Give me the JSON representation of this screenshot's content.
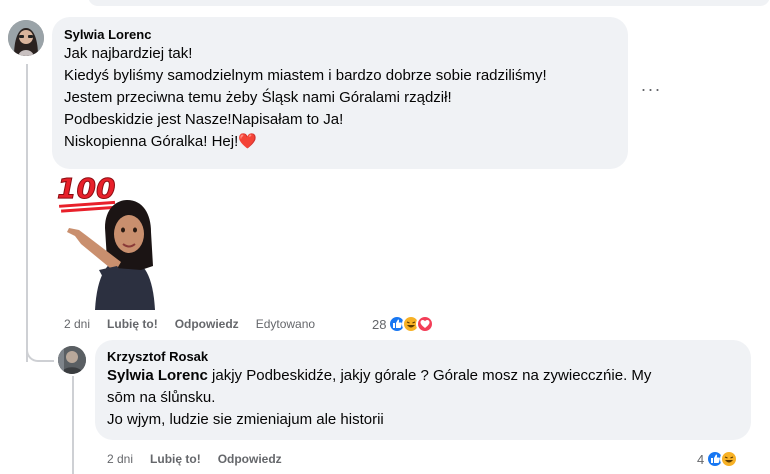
{
  "comment": {
    "author": "Sylwia Lorenc",
    "lines": [
      "Jak najbardziej tak!",
      "Kiedyś byliśmy samodzielnym miastem i bardzo dobrze sobie radziliśmy!",
      "Jestem przeciwna temu żeby Śląsk nami Góralami rządził!",
      "Podbeskidzie jest Nasze!Napisałam to Ja!",
      "Niskopienna Góralka! Hej!❤️"
    ],
    "sticker_text": "100",
    "more_label": "···",
    "time": "2 dni",
    "like_label": "Lubię to!",
    "reply_label": "Odpowiedz",
    "edited_label": "Edytowano",
    "reaction_count": "28",
    "reactions": [
      "like",
      "haha",
      "love"
    ]
  },
  "reply": {
    "author": "Krzysztof Rosak",
    "mention": "Sylwia Lorenc",
    "line1_rest": " jakjy Podbeskidźe, jakjy górale ? Górale mosz na zywiecczńie. My",
    "line2": "sōm na ślůnsku.",
    "line3": "Jo wjym, ludzie sie zmieniajum ale historii",
    "time": "2 dni",
    "like_label": "Lubię to!",
    "reply_label": "Odpowiedz",
    "reaction_count": "4",
    "reactions": [
      "like",
      "haha"
    ]
  },
  "colors": {
    "bubble": "#f0f2f5",
    "like": "#1877f2",
    "haha": "#f7b125",
    "love": "#f33e58",
    "meta_text": "#65676b"
  }
}
